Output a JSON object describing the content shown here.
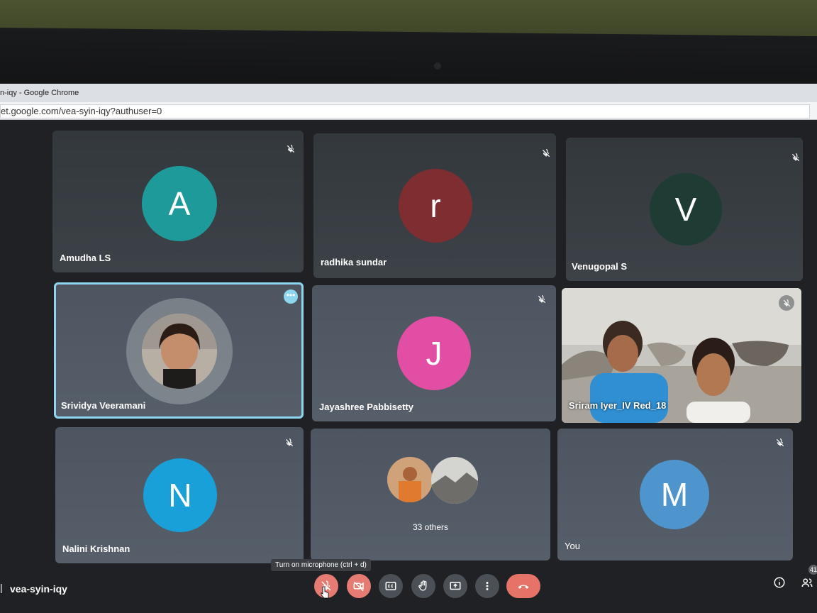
{
  "browser": {
    "window_title": "n-iqy - Google Chrome",
    "url": "et.google.com/vea-syin-iqy?authuser=0"
  },
  "tiles": [
    {
      "name": "Amudha LS",
      "initial": "A",
      "color": "#1f9a9a"
    },
    {
      "name": "radhika sundar",
      "initial": "r",
      "color": "#7e2e31"
    },
    {
      "name": "Venugopal S",
      "initial": "V",
      "color": "#1f3c34"
    },
    {
      "name": "Srividya Veeramani"
    },
    {
      "name": "Jayashree Pabbisetty",
      "initial": "J",
      "color": "#e14ea3"
    },
    {
      "name": "Sriram Iyer_IV Red_18"
    },
    {
      "name": "Nalini Krishnan",
      "initial": "N",
      "color": "#1aa0d8"
    },
    {
      "name": "33 others"
    },
    {
      "name": "You",
      "initial": "M",
      "color": "#4e94cd"
    }
  ],
  "controls": {
    "tooltip": "Turn on microphone (ctrl + d)",
    "meeting_code": "vea-syin-iqy",
    "participant_count": "41"
  },
  "colors": {
    "accent": "#8ed6ee",
    "mic_off": "#e67b73",
    "end_call": "#e57368"
  }
}
